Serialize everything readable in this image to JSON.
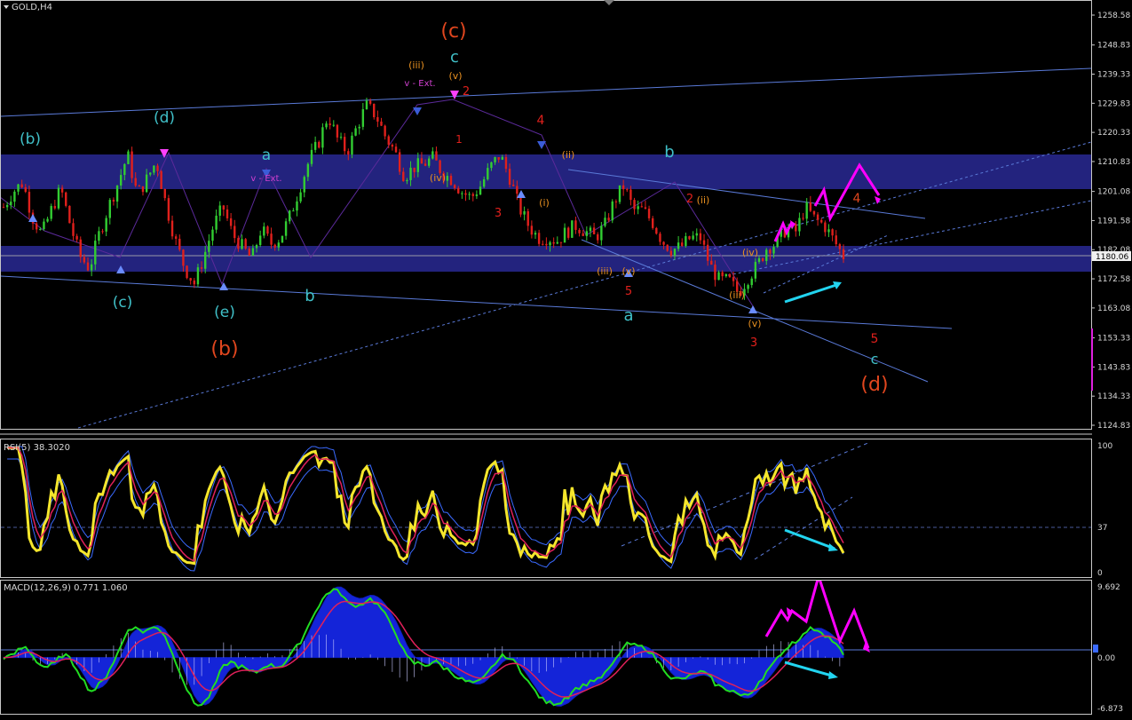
{
  "chart_data": [
    {
      "type": "candlestick",
      "title": "GOLD,H4",
      "symbol": "GOLD",
      "timeframe": "H4",
      "current_price": "1180.06",
      "price_ticks": [
        "1258.58",
        "1248.83",
        "1239.33",
        "1229.83",
        "1220.33",
        "1210.83",
        "1201.08",
        "1191.58",
        "1182.08",
        "1172.58",
        "1163.08",
        "1153.33",
        "1143.83",
        "1134.33",
        "1124.83"
      ],
      "ylim": [
        1124.83,
        1258.58
      ],
      "close_path": [
        1196,
        1201,
        1204,
        1193,
        1187,
        1195,
        1202,
        1190,
        1180,
        1176,
        1187,
        1196,
        1204,
        1213,
        1200,
        1205,
        1211,
        1197,
        1185,
        1176,
        1171,
        1180,
        1190,
        1196,
        1187,
        1183,
        1179,
        1189,
        1184,
        1186,
        1193,
        1202,
        1211,
        1217,
        1226,
        1218,
        1214,
        1222,
        1229,
        1226,
        1219,
        1214,
        1206,
        1209,
        1210,
        1212,
        1207,
        1205,
        1201,
        1199,
        1203,
        1209,
        1213,
        1206,
        1196,
        1190,
        1186,
        1186,
        1185,
        1188,
        1190,
        1188,
        1186,
        1190,
        1198,
        1203,
        1195,
        1195,
        1191,
        1185,
        1182,
        1183,
        1186,
        1186,
        1177,
        1172,
        1172,
        1168,
        1173,
        1177,
        1183,
        1184,
        1189,
        1188,
        1196,
        1192,
        1190,
        1185,
        1180
      ],
      "colors": {
        "bull": "#32CD32",
        "bear": "#E0201C",
        "grid": "#2a2a2a",
        "axis": "#c8c8c8",
        "zone": "#2A2A8C",
        "channel": "#5a7ad8"
      },
      "annotations": {
        "red_c": "(c)",
        "cyan_c": "c",
        "iii_top": "(iii)",
        "v_top": "(v)",
        "v_ext_top": "v - Ext.",
        "two_top": "2",
        "one_top": "1",
        "b_left": "(b)",
        "d_paren": "(d)",
        "c_paren_left": "(c)",
        "e_paren": "(e)",
        "b_red": "(b)",
        "a_left": "a",
        "v_ext_left": "v - Ext.",
        "b_cyan_left": "b",
        "four_red": "4",
        "three_red": "3",
        "ii_orange": "(ii)",
        "i_orange": "(i)",
        "iv_orange": "(iv)",
        "b_cyan_right": "b",
        "two_red": "2",
        "ii_orange2": "(ii)",
        "a_cyan_right": "a",
        "five_red": "5",
        "iii_orange": "(iii)",
        "v_orange": "(v)",
        "iv_orange2": "(iv)",
        "iii_orange2": "(iii)",
        "v_orange2": "(v)",
        "three_red2": "3",
        "four_red2": "4",
        "five_red2": "5",
        "c_cyan2": "c",
        "d_paren_red": "(d)"
      }
    },
    {
      "type": "line",
      "title": "RSI(5) 38.3020",
      "ylim": [
        0,
        100
      ],
      "ticks": [
        "100",
        "37",
        "0"
      ],
      "level": 37
    },
    {
      "type": "histogram",
      "title": "MACD(12,26,9) 0.771 1.060",
      "ticks": [
        "9.692",
        "0.00",
        "-6.873"
      ],
      "ylim": [
        -6.873,
        9.692
      ]
    }
  ]
}
